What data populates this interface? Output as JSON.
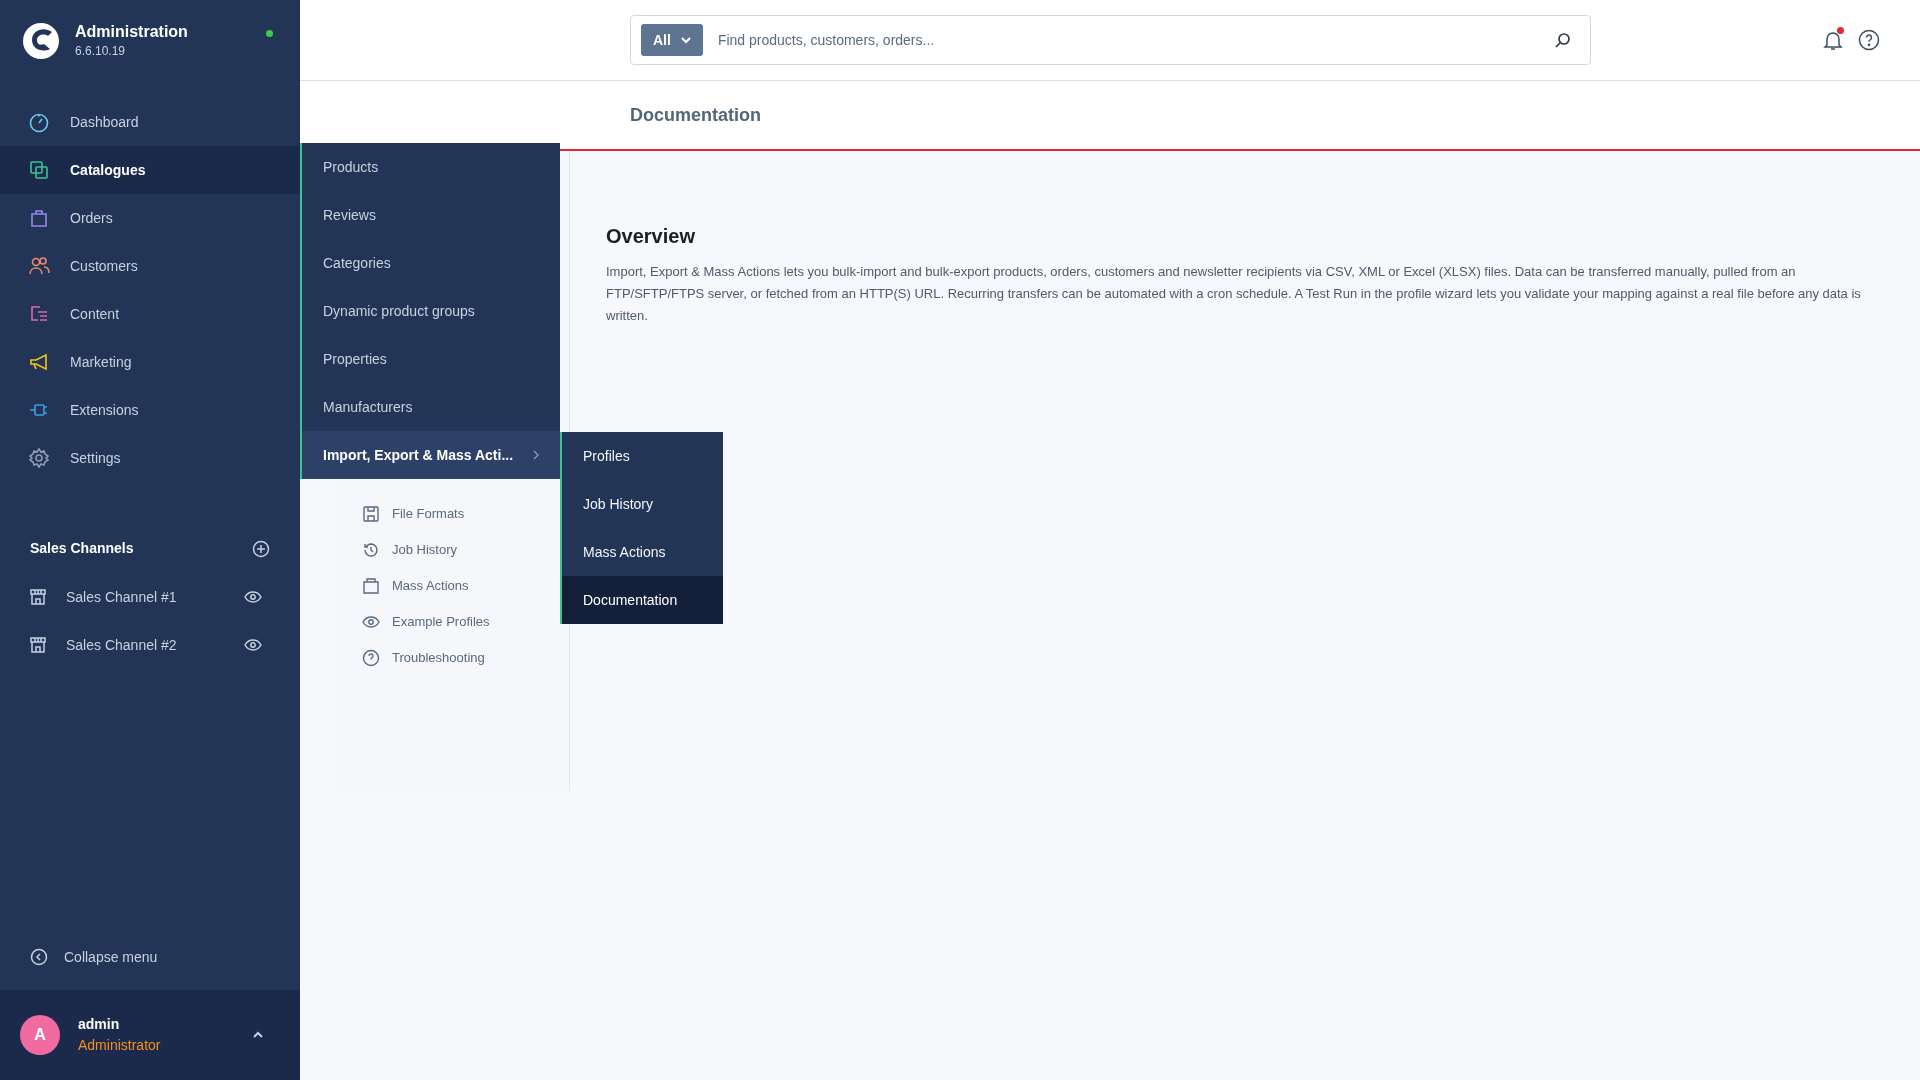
{
  "brand": {
    "title": "Administration",
    "version": "6.6.10.19",
    "online": true
  },
  "nav": [
    {
      "label": "Dashboard",
      "kind": "dashboard",
      "selected": false
    },
    {
      "label": "Catalogues",
      "kind": "catalogues",
      "selected": true
    },
    {
      "label": "Orders",
      "kind": "orders",
      "selected": false
    },
    {
      "label": "Customers",
      "kind": "customers",
      "selected": false
    },
    {
      "label": "Content",
      "kind": "content",
      "selected": false
    },
    {
      "label": "Marketing",
      "kind": "marketing",
      "selected": false
    },
    {
      "label": "Extensions",
      "kind": "extensions",
      "selected": false
    },
    {
      "label": "Settings",
      "kind": "settings",
      "selected": false
    }
  ],
  "sales_channels": {
    "title": "Sales Channels",
    "items": [
      {
        "label": "Sales Channel #1"
      },
      {
        "label": "Sales Channel #2"
      }
    ]
  },
  "collapse_menu": "Collapse menu",
  "user": {
    "initial": "A",
    "name": "admin",
    "role": "Administrator"
  },
  "search": {
    "scope": "All",
    "placeholder": "Find products, customers, orders..."
  },
  "notifications": {
    "unread": true
  },
  "page_title": "Documentation",
  "flyout": [
    {
      "label": "Products",
      "selected": false,
      "has_children": false
    },
    {
      "label": "Reviews",
      "selected": false,
      "has_children": false
    },
    {
      "label": "Categories",
      "selected": false,
      "has_children": false
    },
    {
      "label": "Dynamic product groups",
      "selected": false,
      "has_children": false
    },
    {
      "label": "Properties",
      "selected": false,
      "has_children": false
    },
    {
      "label": "Manufacturers",
      "selected": false,
      "has_children": false
    },
    {
      "label": "Import, Export & Mass Acti...",
      "selected": true,
      "has_children": true
    }
  ],
  "subflyout": [
    {
      "label": "Profiles",
      "selected": false
    },
    {
      "label": "Job History",
      "selected": false
    },
    {
      "label": "Mass Actions",
      "selected": false
    },
    {
      "label": "Documentation",
      "selected": true
    }
  ],
  "doc_nav": [
    {
      "label": "File Formats",
      "kind": "file"
    },
    {
      "label": "Job History",
      "kind": "history"
    },
    {
      "label": "Mass Actions",
      "kind": "bag"
    },
    {
      "label": "Example Profiles",
      "kind": "eye"
    },
    {
      "label": "Troubleshooting",
      "kind": "help"
    }
  ],
  "overview": {
    "title": "Overview",
    "text": "Import, Export & Mass Actions lets you bulk-import and bulk-export products, orders, customers and newsletter recipients via CSV, XML or Excel (XLSX) files. Data can be transferred manually, pulled from an FTP/SFTP/FTPS server, or fetched from an HTTP(S) URL. Recurring transfers can be automated with a cron schedule. A Test Run in the profile wizard lets you validate your mapping against a real file before any data is written."
  }
}
